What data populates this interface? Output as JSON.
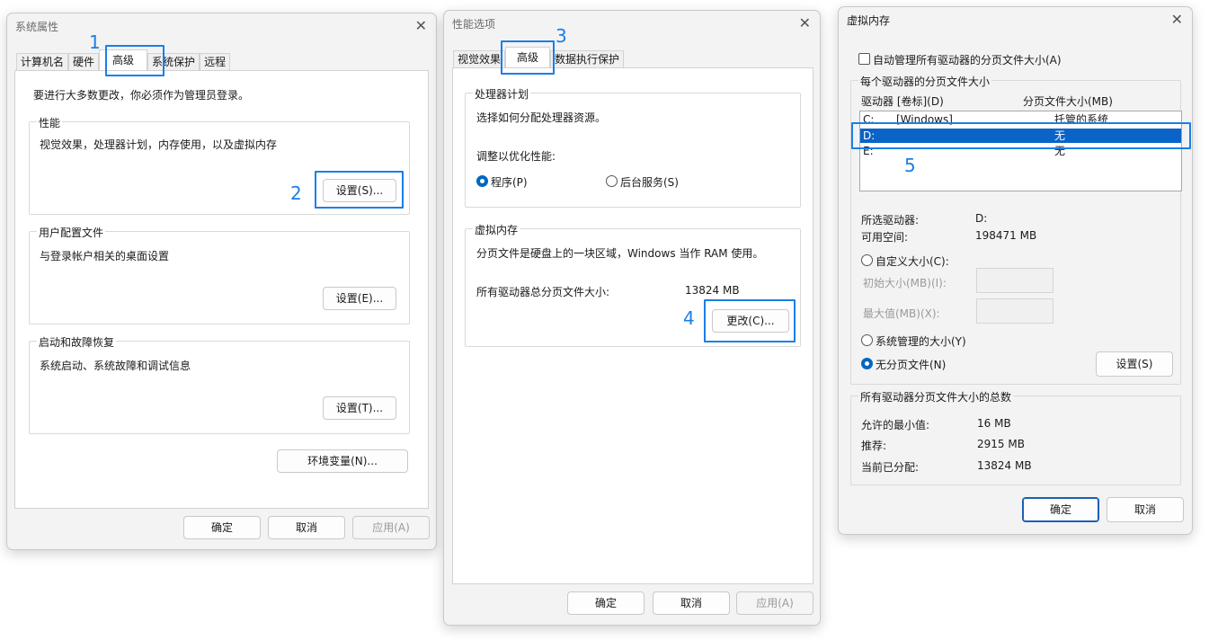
{
  "sys": {
    "title": "系统属性",
    "tabs": [
      "计算机名",
      "硬件",
      "高级",
      "系统保护",
      "远程"
    ],
    "admin_note": "要进行大多数更改，你必须作为管理员登录。",
    "perf": {
      "label": "性能",
      "desc": "视觉效果，处理器计划，内存使用，以及虚拟内存",
      "button": "设置(S)..."
    },
    "profile": {
      "label": "用户配置文件",
      "desc": "与登录帐户相关的桌面设置",
      "button": "设置(E)..."
    },
    "startup": {
      "label": "启动和故障恢复",
      "desc": "系统启动、系统故障和调试信息",
      "button": "设置(T)..."
    },
    "env_button": "环境变量(N)...",
    "ok": "确定",
    "cancel": "取消",
    "apply": "应用(A)"
  },
  "perf": {
    "title": "性能选项",
    "tabs": [
      "视觉效果",
      "高级",
      "数据执行保护"
    ],
    "cpu": {
      "label": "处理器计划",
      "desc": "选择如何分配处理器资源。",
      "optimize": "调整以优化性能:",
      "programs": "程序(P)",
      "services": "后台服务(S)"
    },
    "vm": {
      "label": "虚拟内存",
      "desc": "分页文件是硬盘上的一块区域，Windows 当作 RAM 使用。",
      "total_label": "所有驱动器总分页文件大小:",
      "total_value": "13824 MB",
      "change_button": "更改(C)..."
    },
    "ok": "确定",
    "cancel": "取消",
    "apply": "应用(A)"
  },
  "vmem": {
    "title": "虚拟内存",
    "auto_manage": "自动管理所有驱动器的分页文件大小(A)",
    "per_drive_label": "每个驱动器的分页文件大小",
    "col_drive": "驱动器 [卷标](D)",
    "col_size": "分页文件大小(MB)",
    "drives": [
      {
        "drive": "C:",
        "volume": "[Windows]",
        "size": "托管的系统"
      },
      {
        "drive": "D:",
        "volume": "",
        "size": "无"
      },
      {
        "drive": "E:",
        "volume": "",
        "size": "无"
      }
    ],
    "selected_label": "所选驱动器:",
    "selected_value": "D:",
    "free_label": "可用空间:",
    "free_value": "198471 MB",
    "custom": "自定义大小(C):",
    "initial": "初始大小(MB)(I):",
    "max": "最大值(MB)(X):",
    "system_managed": "系统管理的大小(Y)",
    "no_paging": "无分页文件(N)",
    "set_button": "设置(S)",
    "total_label": "所有驱动器分页文件大小的总数",
    "min_label": "允许的最小值:",
    "min_value": "16 MB",
    "rec_label": "推荐:",
    "rec_value": "2915 MB",
    "cur_label": "当前已分配:",
    "cur_value": "13824 MB",
    "ok": "确定",
    "cancel": "取消"
  },
  "annotations": [
    "1",
    "2",
    "3",
    "4",
    "5"
  ],
  "colors": {
    "highlight": "#1a7fe8",
    "selection": "#0a64c8",
    "radio_on": "#0067c0"
  }
}
